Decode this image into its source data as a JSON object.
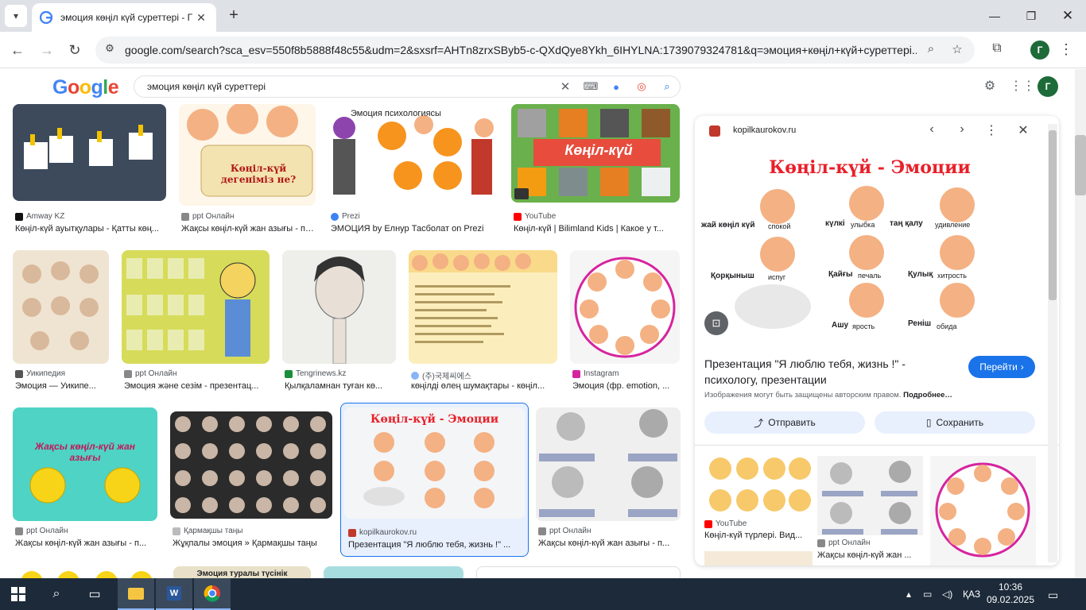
{
  "browser": {
    "tab_title": "эмоция көңіл күй суреттері - Г",
    "url": "google.com/search?sca_esv=550f8b5888f48c55&udm=2&sxsrf=AHTn8zrxSByb5-c-QXdQye8Ykh_6IHYLNA:1739079324781&q=эмоция+көңіл+күй+суреттері...",
    "profile_letter": "Г"
  },
  "google": {
    "logo": "Google",
    "query": "эмоция көңіл күй суреттері",
    "profile_letter": "Г"
  },
  "results": [
    {
      "source": "Amway KZ",
      "title": "Көңіл-күй ауытқулары - Қатты көң..."
    },
    {
      "source": "ppt Онлайн",
      "title": "Жақсы көңіл-күй жан азығы - презе..."
    },
    {
      "source": "Prezi",
      "title": "ЭМОЦИЯ by Елнур Тасболат on Prezi"
    },
    {
      "source": "YouTube",
      "title": "Көңіл-күй | Bilimland Kids | Какое у т..."
    },
    {
      "source": "Уикипедия",
      "title": "Эмоция — Уикипе..."
    },
    {
      "source": "ppt Онлайн",
      "title": "Эмоция және сезім - презентац..."
    },
    {
      "source": "Tengrinews.kz",
      "title": "Қылқаламнан туған кө..."
    },
    {
      "source": "(주)국제씨에스",
      "title": "көңілді өлең шумақтары - көңіл..."
    },
    {
      "source": "Instagram",
      "title": "Эмоция (фр. emotion, ..."
    },
    {
      "source": "ppt Онлайн",
      "title": "Жақсы көңіл-күй жан азығы - п..."
    },
    {
      "source": "Қармақшы таңы",
      "title": "Жұқпалы эмоция » Қармақшы таңы"
    },
    {
      "source": "kopilkaurokov.ru",
      "title": "Презентация \"Я люблю тебя, жизнь !\" ..."
    },
    {
      "source": "ppt Онлайн",
      "title": "Жақсы көңіл-күй жан азығы - п..."
    }
  ],
  "thumb_text": {
    "r1c2": "Көңіл-күй дегеніміз не?",
    "r1c3": "Эмоция психологиясы",
    "r1c4": "Көңіл-күй",
    "r3c1": "Жақсы көңіл-күй жан азығы",
    "r3c3": "Көңіл-күй - Эмоции",
    "r4c2": "Эмоция туралы түсінік"
  },
  "panel": {
    "site": "kopilkaurokov.ru",
    "image_title": "Көңіл-күй - Эмоции",
    "labels": [
      "жай көңіл күй",
      "спокой",
      "күлкі",
      "улыбка",
      "таң қалу",
      "удивление",
      "Қорқыныш",
      "испуг",
      "Қайғы",
      "печаль",
      "Қулық",
      "хитрость",
      "Ашу",
      "ярость",
      "Реніш",
      "обида"
    ],
    "title": "Презентация \"Я люблю тебя, жизнь !\" - психологу, презентации",
    "go_label": "Перейти",
    "copyright": "Изображения могут быть защищены авторским правом.",
    "more": "Подробнее…",
    "share_label": "Отправить",
    "save_label": "Сохранить",
    "related": [
      {
        "source": "YouTube",
        "title": "Көңіл-күй түрлері. Вид..."
      },
      {
        "source": "ppt Онлайн",
        "title": "Жақсы көңіл-күй жан ..."
      }
    ]
  },
  "taskbar": {
    "lang": "ҚАЗ",
    "time": "10:36",
    "date": "09.02.2025"
  },
  "colors": {
    "accent": "#1a73e8",
    "red_title": "#e8202a",
    "taskbar": "#1c2a3a"
  }
}
